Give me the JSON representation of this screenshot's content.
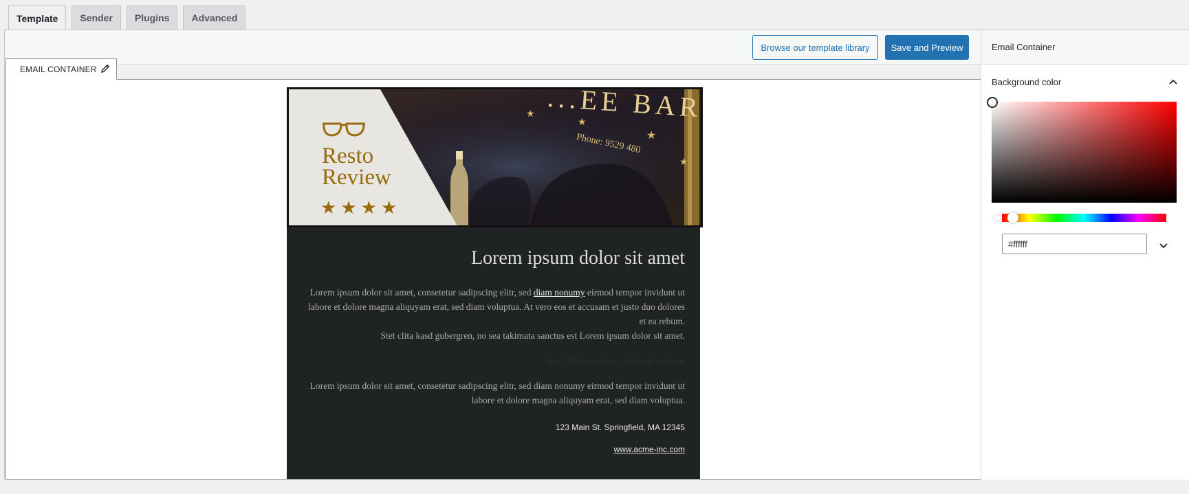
{
  "tabs": [
    {
      "label": "Template",
      "active": true
    },
    {
      "label": "Sender",
      "active": false
    },
    {
      "label": "Plugins",
      "active": false
    },
    {
      "label": "Advanced",
      "active": false
    }
  ],
  "toolbar": {
    "browse_label": "Browse our template library",
    "save_label": "Save and Preview"
  },
  "canvas": {
    "tab_label": "EMAIL CONTAINER"
  },
  "email": {
    "logo_line1": "Resto",
    "logo_line2": "Review",
    "stars": 4,
    "hero_sign_text": "...EE BAR",
    "hero_phone_text": "Phone: 9529 480",
    "heading": "Lorem ipsum dolor sit amet",
    "para1_before": "Lorem ipsum dolor sit amet, consetetur sadipscing elitr, sed ",
    "para1_link": "diam nonumy",
    "para1_after": " eirmod tempor invidunt ut labore et dolore magna aliquyam erat, sed diam voluptua. At vero eos et accusam et justo duo dolores et ea rebum.",
    "para1_line2": "Stet clita kasd gubergren, no sea takimata sanctus est Lorem ipsum dolor sit amet.",
    "faded_heading": "Sed diam nonumy eirmod tempor",
    "para2": "Lorem ipsum dolor sit amet, consetetur sadipscing elitr, sed diam nonumy eirmod tempor invidunt ut labore et dolore magna aliquyam erat, sed diam voluptua.",
    "address": "123 Main St. Springfield, MA 12345",
    "website": "www.acme-inc.com"
  },
  "sidebar": {
    "title": "Email Container",
    "section_label": "Background color",
    "hex_value": "#ffffff"
  },
  "colors": {
    "accent": "#2271b1",
    "email_bg": "#1f2324",
    "logo_gold": "#9a6a0e",
    "hero_left_bg": "#e8e6e1"
  }
}
